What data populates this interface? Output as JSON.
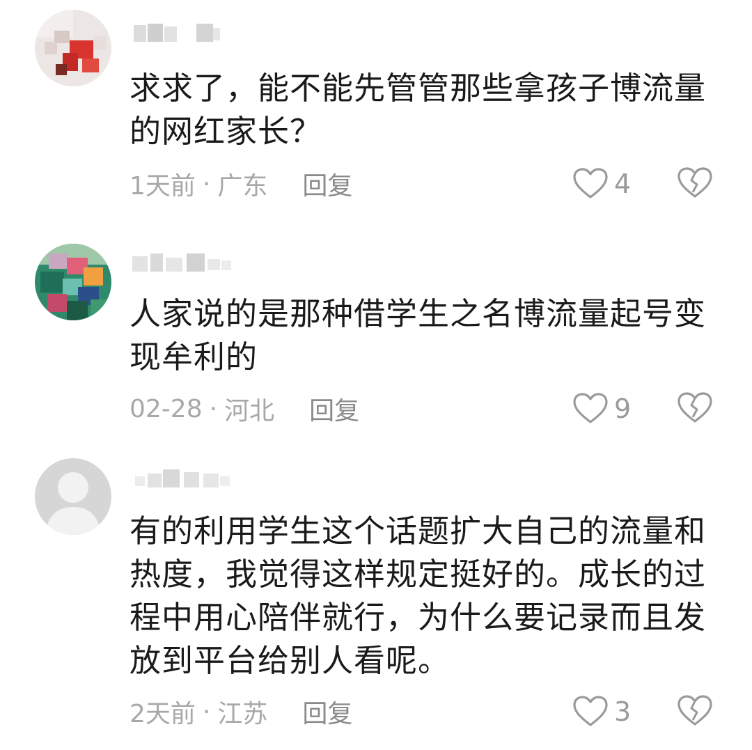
{
  "comments": [
    {
      "text": "求求了，能不能先管管那些拿孩子博流量的网红家长？",
      "time": "1天前",
      "separator": "·",
      "location": "广东",
      "reply_label": "回复",
      "likes": "4",
      "avatar_icon": "blurred-avatar-red-white"
    },
    {
      "text": "人家说的是那种借学生之名博流量起号变现牟利的",
      "time": "02-28",
      "separator": "·",
      "location": "河北",
      "reply_label": "回复",
      "likes": "9",
      "avatar_icon": "blurred-avatar-green-colorful"
    },
    {
      "text": "有的利用学生这个话题扩大自己的流量和热度，我觉得这样规定挺好的。成长的过程中用心陪伴就行，为什么要记录而且发放到平台给别人看呢。",
      "time": "2天前",
      "separator": "·",
      "location": "江苏",
      "reply_label": "回复",
      "likes": "3",
      "avatar_icon": "default-avatar-gray"
    }
  ],
  "icons": {
    "like": "heart-outline-icon",
    "dislike": "broken-heart-icon"
  },
  "colors": {
    "text": "#1a1a1a",
    "meta": "#a8a8a8",
    "icon": "#9a9a9a"
  }
}
